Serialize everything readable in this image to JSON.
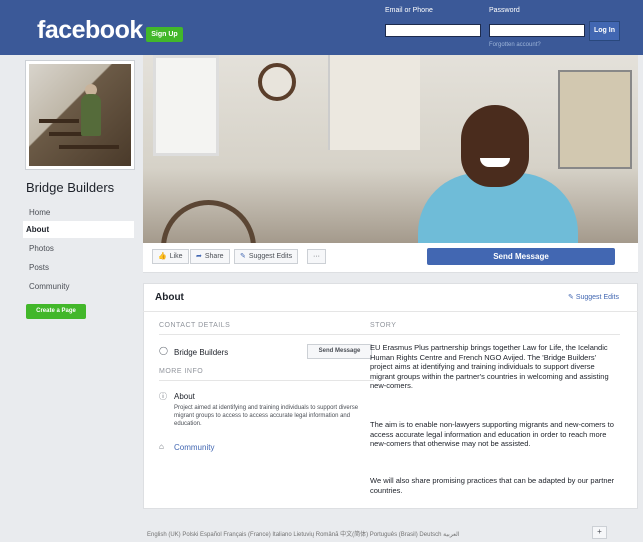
{
  "header": {
    "logo": "facebook",
    "signup_label": "Sign Up",
    "email_label": "Email or Phone",
    "password_label": "Password",
    "login_label": "Log In",
    "forgot_label": "Forgotten account?"
  },
  "sidebar": {
    "page_name": "Bridge Builders",
    "items": [
      {
        "label": "Home",
        "active": false
      },
      {
        "label": "About",
        "active": true
      },
      {
        "label": "Photos",
        "active": false
      },
      {
        "label": "Posts",
        "active": false
      },
      {
        "label": "Community",
        "active": false
      }
    ],
    "create_page_label": "Create a Page"
  },
  "actions": {
    "like": "Like",
    "share": "Share",
    "suggest": "Suggest Edits",
    "more": "···",
    "send_message": "Send Message"
  },
  "about": {
    "title": "About",
    "suggest_edits": "Suggest Edits",
    "contact_header": "CONTACT DETAILS",
    "contact_name": "Bridge Builders",
    "send_message": "Send Message",
    "more_info_header": "MORE INFO",
    "about_label": "About",
    "about_text": "Project aimed at identifying and training individuals to support diverse migrant groups to access to access accurate legal information and education.",
    "community_label": "Community",
    "story_header": "STORY",
    "story_p1": "EU Erasmus Plus partnership brings together Law for Life, the Icelandic Human Rights Centre and French NGO Avijed. The 'Bridge Builders' project aims at identifying and training individuals to support diverse migrant groups within the partner's countries in welcoming and assisting new-comers.",
    "story_p2": "The aim is to enable non-lawyers supporting migrants and new-comers to access accurate legal information and education in order to reach more new-comers that otherwise may not be assisted.",
    "story_p3": "We will also share promising practices that can be adapted by our partner countries."
  },
  "footer": {
    "languages": "English (UK)  Polski  Español  Français (France)  Italiano  Lietuvių  Română  中文(简体)  Português (Brasil)  Deutsch  العربية",
    "plus": "+"
  },
  "colors": {
    "brand": "#3b5998",
    "button": "#4267b2",
    "green": "#42b72a"
  }
}
